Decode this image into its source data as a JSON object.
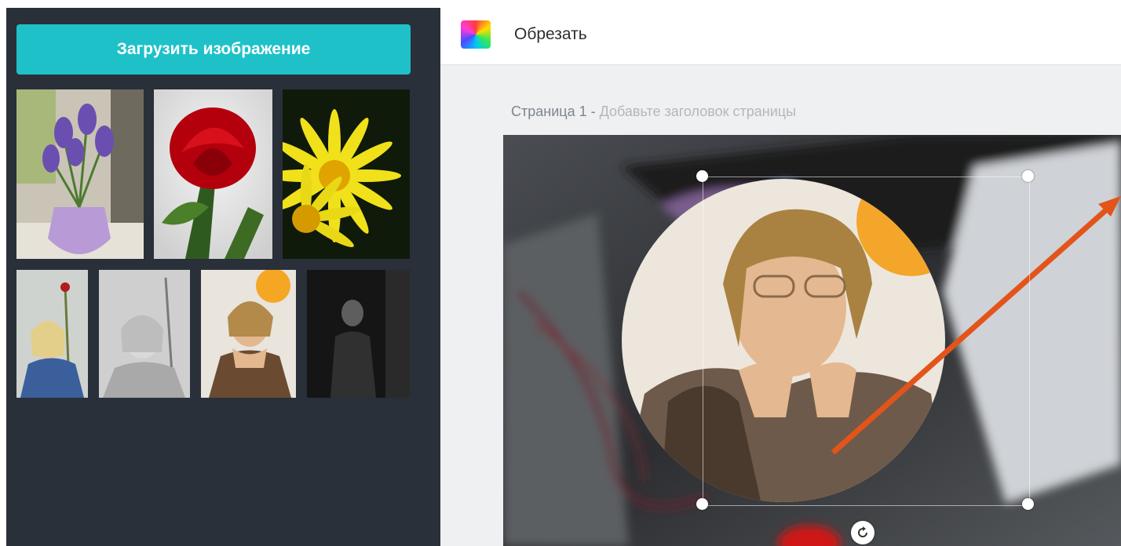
{
  "sidebar": {
    "upload_label": "Загрузить изображение",
    "thumbnails": [
      {
        "name": "lilac-crocus-bouquet"
      },
      {
        "name": "red-rose"
      },
      {
        "name": "yellow-daisy-flowers"
      },
      {
        "name": "woman-with-flower-color"
      },
      {
        "name": "woman-bw-portrait"
      },
      {
        "name": "woman-chin-on-hands"
      },
      {
        "name": "man-dark-portrait"
      }
    ]
  },
  "topbar": {
    "title": "Обрезать"
  },
  "page": {
    "number_label": "Страница 1 - ",
    "title_placeholder": "Добавьте заголовок страницы"
  },
  "colors": {
    "sidebar_bg": "#293039",
    "upload_button": "#1fc1c9",
    "workspace_bg": "#eef0f2",
    "annotation_arrow": "#e3541a"
  },
  "icons": {
    "rotate": "rotate-icon",
    "logo": "color-palette-logo"
  }
}
